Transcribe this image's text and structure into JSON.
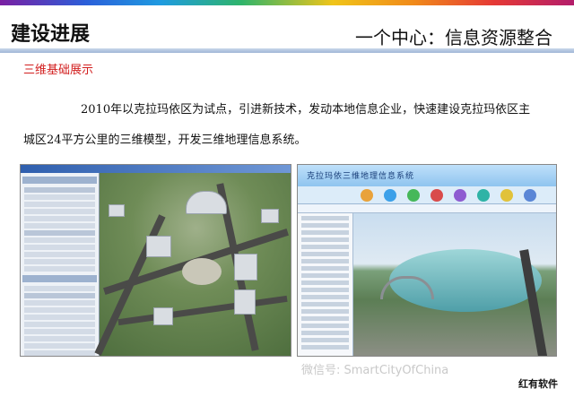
{
  "header": {
    "left_title": "建设进展",
    "right_title": "一个中心：信息资源整合"
  },
  "subtitle": "三维基础展示",
  "body": {
    "line1": "2010年以克拉玛依区为试点，引进新技术，发动本地信息企业，快速建设克拉玛依区主",
    "line2": "城区24平方公里的三维模型，开发三维地理信息系统。"
  },
  "screenshots": {
    "right_title": "克拉玛依三维地理信息系统"
  },
  "footer": {
    "watermark": "微信号: SmartCityOfChina",
    "brand": "红有软件"
  }
}
